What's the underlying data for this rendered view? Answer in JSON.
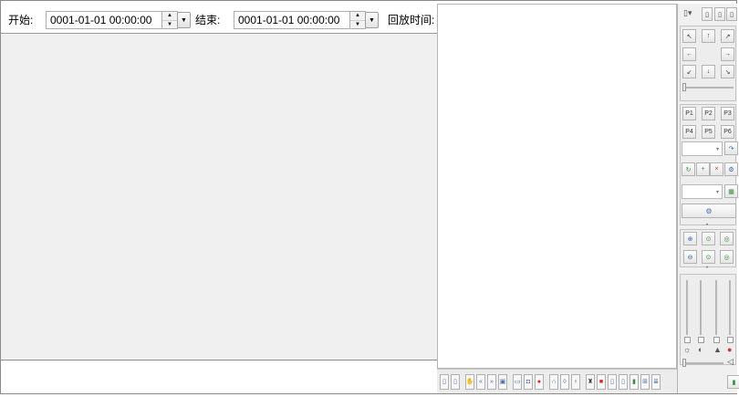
{
  "query": {
    "start_label": "开始:",
    "start_value": "0001-01-01 00:00:00",
    "end_label": "结束:",
    "end_value": "0001-01-01 00:00:00",
    "playback_label": "回放时间:"
  },
  "spin": {
    "up": "▲",
    "down": "▼"
  },
  "dropdown_glyph": "▼",
  "ptz": {
    "view_icons": [
      "▯▾",
      "▯",
      "▯",
      "▯"
    ],
    "directions": {
      "up_left": "↖",
      "up": "↑",
      "up_right": "↗",
      "left": "←",
      "right": "→",
      "down_left": "↙",
      "down": "↓",
      "down_right": "↘"
    },
    "presets": [
      "P1",
      "P2",
      "P3",
      "P4",
      "P5",
      "P6"
    ],
    "combo_arrow": "▾",
    "dot": "•"
  },
  "colors": {
    "main_bg": "#f0f0f0",
    "panel_bg": "#ffffff",
    "border": "#8a8a8a",
    "accent": "#4b6fa8"
  }
}
